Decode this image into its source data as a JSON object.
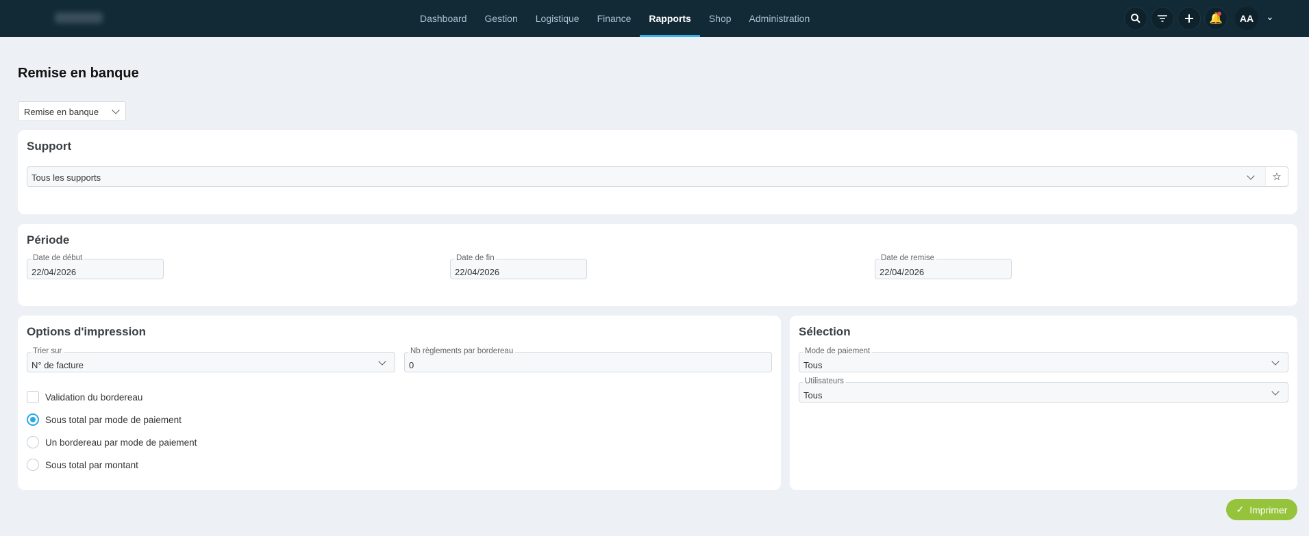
{
  "header": {
    "nav": [
      "Dashboard",
      "Gestion",
      "Logistique",
      "Finance",
      "Rapports",
      "Shop",
      "Administration"
    ],
    "active": "Rapports",
    "avatar": "AA"
  },
  "page": {
    "title": "Remise en banque",
    "report_select": "Remise en banque"
  },
  "support": {
    "title": "Support",
    "select": "Tous les supports"
  },
  "periode": {
    "title": "Période",
    "start_label": "Date de début",
    "start": "22/04/2026",
    "end_label": "Date de fin",
    "end": "22/04/2026",
    "remise_label": "Date de remise",
    "remise": "22/04/2026"
  },
  "options": {
    "title": "Options d'impression",
    "sort_label": "Trier sur",
    "sort": "N° de facture",
    "nb_label": "Nb règlements par bordereau",
    "nb": "0",
    "checkbox": "Validation du bordereau",
    "radios": [
      "Sous total par mode de paiement",
      "Un bordereau par mode de paiement",
      "Sous total par montant"
    ]
  },
  "selection": {
    "title": "Sélection",
    "mode_label": "Mode de paiement",
    "mode": "Tous",
    "users_label": "Utilisateurs",
    "users": "Tous"
  },
  "actions": {
    "print": "Imprimer"
  },
  "colors": {
    "header": "#122a36",
    "accent": "#3ab0e8",
    "print": "#95c43c"
  }
}
